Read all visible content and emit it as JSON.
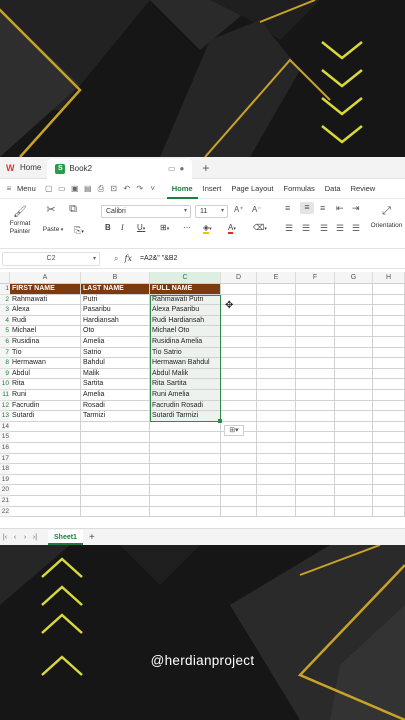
{
  "titlebar": {
    "home_label": "Home",
    "doc_tab": "Book2",
    "new_tab": "+"
  },
  "menubar": {
    "menu_label": "Menu",
    "tabs": [
      "Home",
      "Insert",
      "Page Layout",
      "Formulas",
      "Data",
      "Review"
    ],
    "active_tab": "Home"
  },
  "ribbon": {
    "format_painter": "Format\nPainter",
    "paste": "Paste",
    "font_name": "Calibri",
    "font_size": "11",
    "orientation": "Orientation"
  },
  "formula_bar": {
    "name_box": "C2",
    "fx": "fx",
    "formula": "=A2&\" \"&B2"
  },
  "columns": [
    "A",
    "B",
    "C",
    "D",
    "E",
    "F",
    "G",
    "H"
  ],
  "rows": [
    "1",
    "2",
    "3",
    "4",
    "5",
    "6",
    "7",
    "8",
    "9",
    "10",
    "11",
    "12",
    "13",
    "14",
    "15",
    "16",
    "17",
    "18",
    "19",
    "20",
    "21",
    "22"
  ],
  "table": {
    "headers": [
      "FIRST NAME",
      "LAST NAME",
      "FULL NAME"
    ],
    "rows": [
      [
        "Rahmawati",
        "Putri",
        "Rahmawati Putri"
      ],
      [
        "Alexa",
        "Pasaribu",
        "Alexa Pasaribu"
      ],
      [
        "Rudi",
        "Hardiansah",
        "Rudi Hardiansah"
      ],
      [
        "Michael",
        "Oto",
        "Michael Oto"
      ],
      [
        "Rusidina",
        "Amelia",
        "Rusidina Amelia"
      ],
      [
        "Tio",
        "Satrio",
        "Tio Satrio"
      ],
      [
        "Hermawan",
        "Bahdul",
        "Hermawan Bahdul"
      ],
      [
        "Abdul",
        "Malik",
        "Abdul Malik"
      ],
      [
        "Rita",
        "Sartita",
        "Rita Sartita"
      ],
      [
        "Runi",
        "Amelia",
        "Runi Amelia"
      ],
      [
        "Facrudin",
        "Rosadi",
        "Facrudin Rosadi"
      ],
      [
        "Sutardi",
        "Tarmizi",
        "Sutardi Tarmizi"
      ]
    ]
  },
  "sheets": {
    "active": "Sheet1",
    "add": "+"
  },
  "watermark": "@herdianproject",
  "colors": {
    "accent": "#1a7f3c",
    "header_fill": "#7b3a10",
    "gold": "#c9a227",
    "chevron": "#d9d93a"
  }
}
